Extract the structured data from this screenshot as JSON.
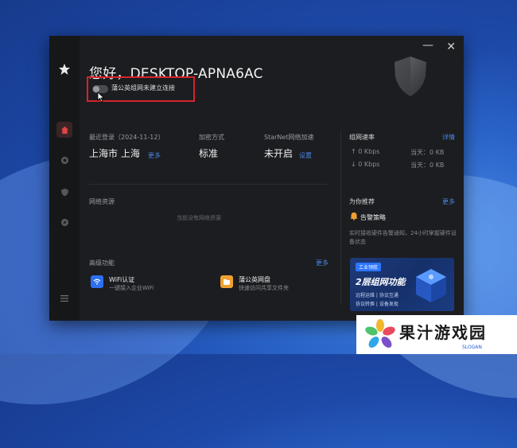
{
  "window": {
    "greeting": "您好，DESKTOP-APNA6AC",
    "toggle_label": "蒲公英组网未建立连接"
  },
  "info": {
    "last_login_label": "最近登录（2024-11-12）",
    "last_login_value": "上海市 上海",
    "last_login_more": "更多",
    "encrypt_label": "加密方式",
    "encrypt_value": "标准",
    "starnet_label": "StarNet网络加速",
    "starnet_value": "未开启",
    "starnet_settings": "设置"
  },
  "speed": {
    "title": "组网速率",
    "details": "详情",
    "up_value": "0 Kbps",
    "down_value": "0 Kbps",
    "today_label": "当天：",
    "today_up": "0 KB",
    "today_down": "0 KB"
  },
  "resources": {
    "title": "网络资源",
    "empty": "当前没有网络资源"
  },
  "recommend": {
    "title": "为你推荐",
    "more": "更多",
    "item_title": "告警策略",
    "item_desc": "实时接收硬件告警通知，24小时掌握硬件设备状态"
  },
  "banner": {
    "tag": "工业领航",
    "title": "2层组网功能",
    "line1": "远程运维 | 协议互通",
    "line2": "协议转换 | 设备发现"
  },
  "advanced": {
    "title": "高级功能",
    "more": "更多",
    "wifi_title": "WiFi认证",
    "wifi_desc": "一键接入企业WiFi",
    "disk_title": "蒲公英网盘",
    "disk_desc": "快速访问共享文件夹"
  },
  "watermark": {
    "name": "果汁游戏园",
    "slogan": "SLOGAN"
  },
  "colors": {
    "accent_blue": "#4a86e8",
    "highlight_red": "#d8232a",
    "active_home": "#e04545"
  }
}
